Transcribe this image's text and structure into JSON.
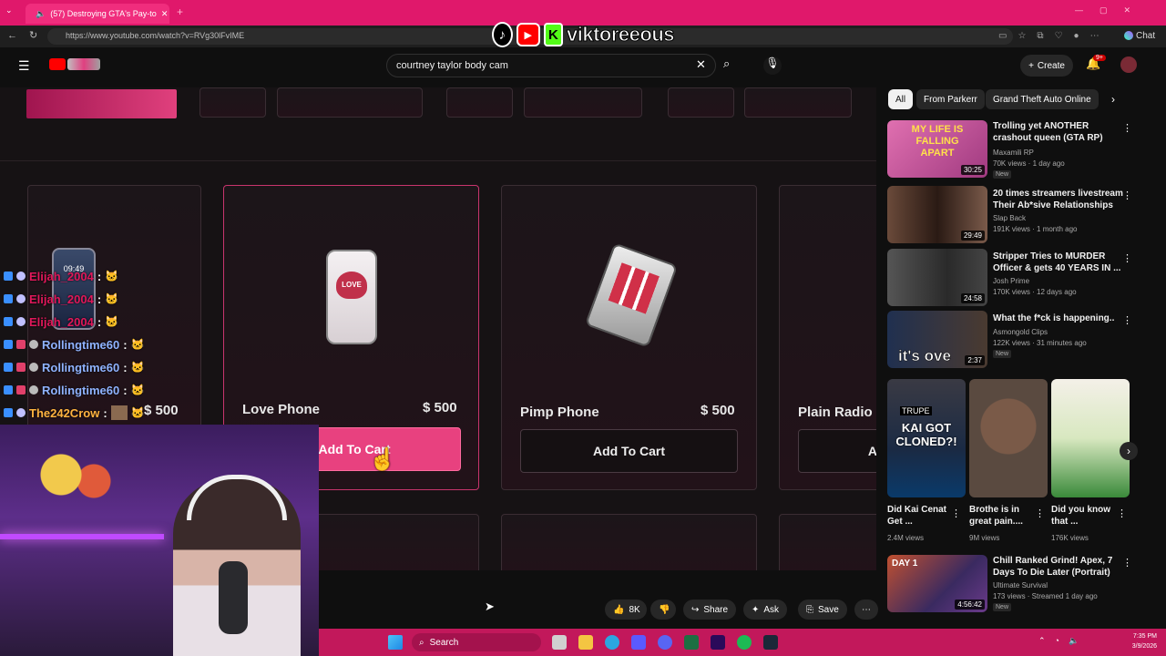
{
  "browser": {
    "tab_title": "(57) Destroying GTA's Pay-to",
    "url": "https://www.youtube.com/watch?v=RVg30lFvIME",
    "chat_label": "Chat"
  },
  "overlay": {
    "channel_name": "viktoreeous"
  },
  "youtube": {
    "search_query": "courtney taylor body cam",
    "create_label": "Create",
    "notif_count": "9+"
  },
  "shop": {
    "products": [
      {
        "name": "Love Phone",
        "price": "$ 500",
        "button": "Add To Cart"
      },
      {
        "name": "Pimp Phone",
        "price": "$ 500",
        "button": "Add To Cart"
      },
      {
        "name": "Plain Radio",
        "button": "A"
      }
    ],
    "left_price": "$ 500",
    "left_phone_time": "09:49"
  },
  "chat": [
    {
      "user": "Elijah_2004",
      "color": "#e0185a",
      "msg": ":"
    },
    {
      "user": "Elijah_2004",
      "color": "#e0185a",
      "msg": ":"
    },
    {
      "user": "Elijah_2004",
      "color": "#e0185a",
      "msg": ":"
    },
    {
      "user": "Rollingtime60",
      "color": "#8fb3ff",
      "msg": ":"
    },
    {
      "user": "Rollingtime60",
      "color": "#8fb3ff",
      "msg": ":"
    },
    {
      "user": "Rollingtime60",
      "color": "#8fb3ff",
      "msg": ":"
    },
    {
      "user": "The242Crow",
      "color": "#ffb340",
      "msg": ":"
    }
  ],
  "actions": {
    "likes": "8K",
    "share": "Share",
    "ask": "Ask",
    "save": "Save"
  },
  "sidebar": {
    "chips": [
      "All",
      "From Parkerr",
      "Grand Theft Auto Online"
    ],
    "videos": [
      {
        "title": "Trolling yet ANOTHER crashout queen (GTA RP)",
        "channel": "Maxamili RP",
        "meta": "70K views · 1 day ago",
        "duration": "30:25",
        "badge": "New",
        "thumb_text": "MY LIFE IS FALLING APART",
        "thumb_color": "#c93d8a"
      },
      {
        "title": "20 times streamers livestream Their Ab*sive Relationships",
        "channel": "Slap Back",
        "meta": "191K views · 1 month ago",
        "duration": "29:49",
        "thumb_color": "#5a3a2a"
      },
      {
        "title": "Stripper Tries to MURDER Officer & gets 40 YEARS IN ...",
        "channel": "Josh Prime",
        "meta": "170K views · 12 days ago",
        "duration": "24:58",
        "thumb_color": "#444"
      },
      {
        "title": "What the f*ck is happening..",
        "channel": "Asmongold Clips",
        "meta": "122K views · 31 minutes ago",
        "duration": "2:37",
        "badge": "New",
        "thumb_text": "it's ove",
        "thumb_color": "#2a3550"
      }
    ],
    "shorts": [
      {
        "title": "Did Kai Cenat Get ...",
        "views": "2.4M views",
        "thumb_text": "KAI GOT CLONED?!",
        "thumb_top": "TRUPE"
      },
      {
        "title": "Brothe is in great pain....",
        "views": "9M views"
      },
      {
        "title": "Did you know that ...",
        "views": "176K views"
      }
    ],
    "bottom_video": {
      "title": "Chill Ranked Grind! Apex, 7 Days To Die Later (Portrait)",
      "channel": "Ultimate Survival",
      "meta": "173 views · Streamed 1 day ago",
      "duration": "4:56:42",
      "badge": "New",
      "thumb_text": "DAY 1"
    }
  },
  "taskbar": {
    "search_label": "Search",
    "time": "7:35 PM",
    "date": "3/9/2026"
  }
}
